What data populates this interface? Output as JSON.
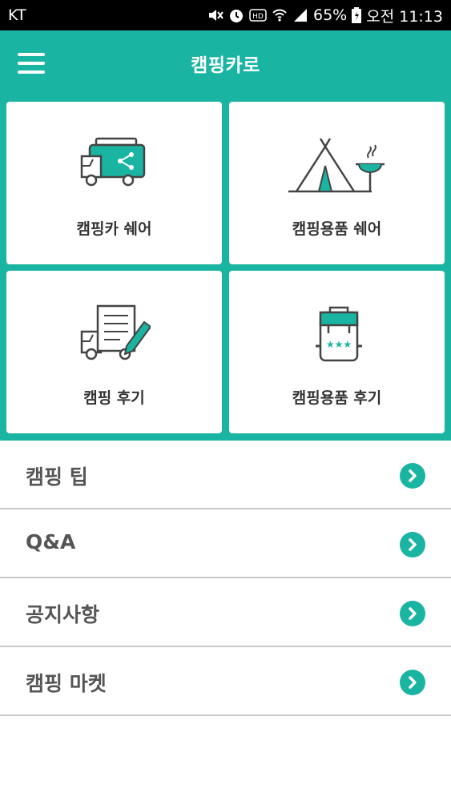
{
  "status_bar": {
    "carrier": "KT",
    "battery": "65%",
    "time": "오전 11:13",
    "icons": [
      "mute-icon",
      "alarm-icon",
      "hd-icon",
      "wifi-icon",
      "signal-icon",
      "battery-icon"
    ]
  },
  "app_bar": {
    "title": "캠핑카로",
    "menu_icon": "hamburger-menu-icon"
  },
  "theme": {
    "accent": "#1ab4a2",
    "text_dark": "#333333",
    "text_list": "#555555",
    "divider": "#c8c8c8"
  },
  "cards": [
    {
      "label": "캠핑카 쉐어",
      "icon": "camper-share-icon"
    },
    {
      "label": "캠핑용품 쉐어",
      "icon": "tent-grill-icon"
    },
    {
      "label": "캠핑 후기",
      "icon": "review-truck-icon"
    },
    {
      "label": "캠핑용품 후기",
      "icon": "backpack-stars-icon"
    }
  ],
  "list": [
    {
      "label": "캠핑 팁",
      "icon": "chevron-right-icon"
    },
    {
      "label": "Q&A",
      "icon": "chevron-right-icon"
    },
    {
      "label": "공지사항",
      "icon": "chevron-right-icon"
    },
    {
      "label": "캠핑 마켓",
      "icon": "chevron-right-icon"
    }
  ]
}
